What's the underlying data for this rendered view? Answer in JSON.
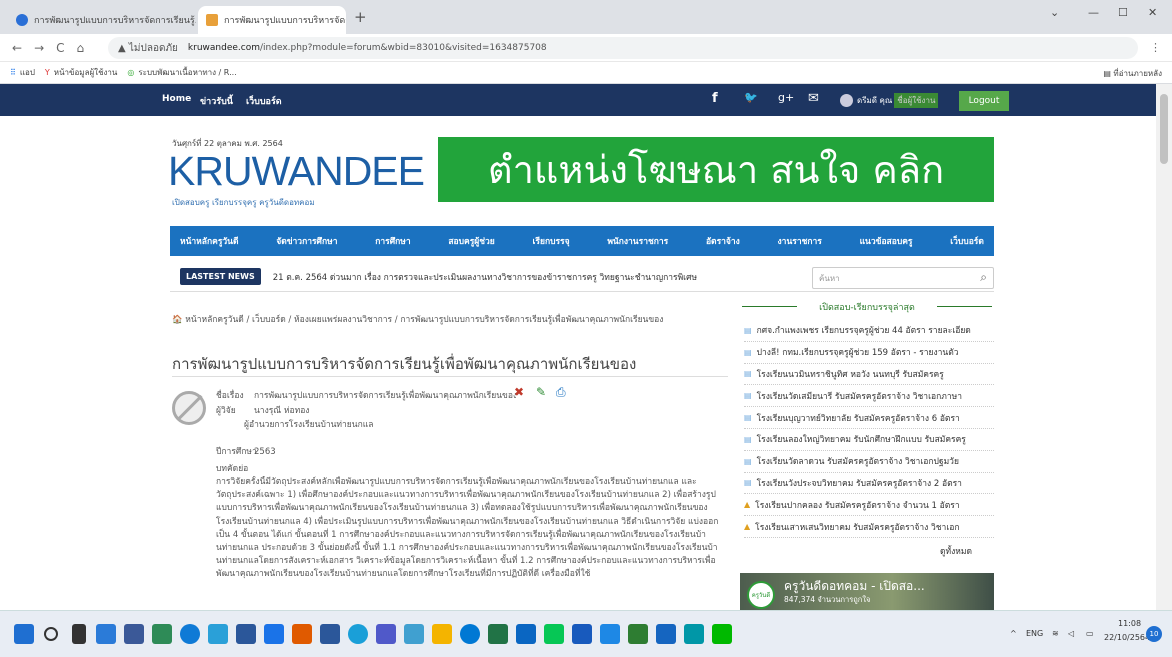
{
  "browser": {
    "tabs": [
      {
        "title": "การพัฒนารูปแบบการบริหารจัดการเรียนรู้...",
        "close": "×"
      },
      {
        "title": "การพัฒนารูปแบบการบริหารจัดการเรี...",
        "close": "×"
      }
    ],
    "new_tab": "+",
    "window_controls": [
      "⌄",
      "—",
      "☐",
      "✕"
    ],
    "nav": {
      "back": "←",
      "forward": "→",
      "reload": "C",
      "home": "⌂"
    },
    "url": {
      "warning": "▲ ไม่ปลอดภัย",
      "host": "kruwandee.com",
      "path": "/index.php?module=forum&wbid=83010&visited=1634875708"
    },
    "url_right_icons": [
      "☆",
      "✱",
      "⋮"
    ],
    "bookmarks": [
      "แอป",
      "หน้าข้อมูลผู้ใช้งาน",
      "ระบบพัฒนาเนื้อหาทาง / R..."
    ],
    "reading_list": "▤ ที่อ่านภายหลัง"
  },
  "site_nav": {
    "links": [
      "Home",
      "ข่าวรับนี้",
      "เว็บบอร์ด"
    ],
    "social_icons": [
      "f",
      "🐦",
      "g+",
      "✉"
    ],
    "user_name": "ดรีมดี คุณ",
    "user_highlight": "ชื่อผู้ใช้งาน",
    "logout": "Logout"
  },
  "header": {
    "date": "วันศุกร์ที่ 22 ตุลาคม พ.ศ. 2564",
    "logo": "KRUWANDEE",
    "tagline": "เปิดสอบครู เรียกบรรจุครู ครูวันดีดอทคอม",
    "banner": "ตำแหน่งโฆษณา สนใจ คลิก"
  },
  "main_menu": [
    "หน้าหลักครูวันดี",
    "จัดข่าวการศึกษา",
    "การศึกษา",
    "สอบครูผู้ช่วย",
    "เรียกบรรจุ",
    "พนักงานราชการ",
    "อัตราจ้าง",
    "งานราชการ",
    "แนวข้อสอบครู",
    "เว็บบอร์ด"
  ],
  "latest_news": {
    "badge": "LASTEST NEWS",
    "text": "21 ต.ค. 2564 ด่วนมาก เรื่อง การตรวจและประเมินผลงานทางวิชาการของข้าราชการครู วิทยฐานะชำนาญการพิเศษ",
    "search_placeholder": "ค้นหา"
  },
  "breadcrumb": "🏠 หน้าหลักครูวันดี / เว็บบอร์ด / ห้องเผยแพร่ผลงานวิชาการ / การพัฒนารูปแบบการบริหารจัดการเรียนรู้เพื่อพัฒนาคุณภาพนักเรียนของ",
  "page_title": "การพัฒนารูปแบบการบริหารจัดการเรียนรู้เพื่อพัฒนาคุณภาพนักเรียนของ",
  "post": {
    "title_label": "ชื่อเรื่อง",
    "title_value": "การพัฒนารูปแบบการบริหารจัดการเรียนรู้เพื่อพัฒนาคุณภาพนักเรียนของโรงเรียนบ้านท่ายนกแล",
    "author_label": "ผู้วิจัย",
    "author_value": "นางรุณี ห่อทอง",
    "position": "ผู้อำนวยการโรงเรียนบ้านท่ายนกแล",
    "year_label": "ปีการศึกษา",
    "year_value": "2563",
    "abstract_label": "บทคัดย่อ",
    "abstract": "การวิจัยครั้งนี้มีวัตถุประสงค์หลักเพื่อพัฒนารูปแบบการบริหารจัดการเรียนรู้เพื่อพัฒนาคุณภาพนักเรียนของโรงเรียนบ้านท่ายนกแล และวัตถุประสงค์เฉพาะ 1) เพื่อศึกษาองค์ประกอบและแนวทางการบริหารเพื่อพัฒนาคุณภาพนักเรียนของโรงเรียนบ้านท่ายนกแล 2) เพื่อสร้างรูปแบบการบริหารเพื่อพัฒนาคุณภาพนักเรียนของโรงเรียนบ้านท่ายนกแล 3) เพื่อทดลองใช้รูปแบบการบริหารเพื่อพัฒนาคุณภาพนักเรียนของโรงเรียนบ้านท่ายนกแล 4) เพื่อประเมินรูปแบบการบริหารเพื่อพัฒนาคุณภาพนักเรียนของโรงเรียนบ้านท่ายนกแล วิธีดำเนินการวิจัย แบ่งออกเป็น 4 ขั้นตอน ได้แก่ ขั้นตอนที่ 1 การศึกษาองค์ประกอบและแนวทางการบริหารจัดการเรียนรู้เพื่อพัฒนาคุณภาพนักเรียนของโรงเรียนบ้านท่ายนกแล ประกอบด้วย 3 ขั้นย่อยดังนี้ ขั้นที่ 1.1 การศึกษาองค์ประกอบและแนวทางการบริหารเพื่อพัฒนาคุณภาพนักเรียนของโรงเรียนบ้านท่ายนกแลโดยการสังเคราะห์เอกสาร วิเคราะห์ข้อมูลโดยการวิเคราะห์เนื้อหา ขั้นที่ 1.2 การศึกษาองค์ประกอบและแนวทางการบริหารเพื่อพัฒนาคุณภาพนักเรียนของโรงเรียนบ้านท่ายนกแลโดยการศึกษาโรงเรียนที่มีการปฏิบัติที่ดี เครื่องมือที่ใช้"
  },
  "sidebar": {
    "heading": "เปิดสอบ-เรียกบรรจุล่าสุด",
    "items": [
      "กศจ.กำแพงเพชร เรียกบรรจุครูผู้ช่วย 44 อัตรา รายละเอียด",
      "ปางลี! กทม.เรียกบรรจุครูผู้ช่วย 159 อัตรา - รายงานตัว",
      "โรงเรียนนวมินทราชินูทิศ หอวัง นนทบุรี รับสมัครครู",
      "โรงเรียนวัดเสมียนารี รับสมัครครูอัตราจ้าง วิชาเอกภาษา",
      "โรงเรียนบุญวาทย์วิทยาลัย รับสมัครครูอัตราจ้าง 6 อัตรา",
      "โรงเรียนลองใหญ่วิทยาคม รับนักศึกษาฝึกแบบ รับสมัครครู",
      "โรงเรียนวัดลาดวน รับสมัครครูอัตราจ้าง วิชาเอกปฐมวัย",
      "โรงเรียนวังประจบวิทยาคม รับสมัครครูอัตราจ้าง 2 อัตรา",
      "โรงเรียนปากคลอง รับสมัครครูอัตราจ้าง จำนวน 1 อัตรา",
      "โรงเรียนเสาหเสนวิทยาคม รับสมัครครูอัตราจ้าง วิชาเอก"
    ],
    "see_all": "ดูทั้งหมด",
    "fb_page": {
      "logo": "ครูวันดี",
      "name": "ครูวันดีดอทคอม - เปิดสอ...",
      "followers": "847,374 จำนวนการถูกใจ"
    }
  },
  "taskbar": {
    "tray_lang": "ENG",
    "time": "11:08",
    "date": "22/10/2564",
    "notif": "10"
  },
  "colors": {
    "site_nav_bg": "#1d3561",
    "menu_bg": "#1b72c0",
    "banner_bg": "#22a43b",
    "logo_blue": "#1d5fa5",
    "logout_green": "#56a84a"
  }
}
